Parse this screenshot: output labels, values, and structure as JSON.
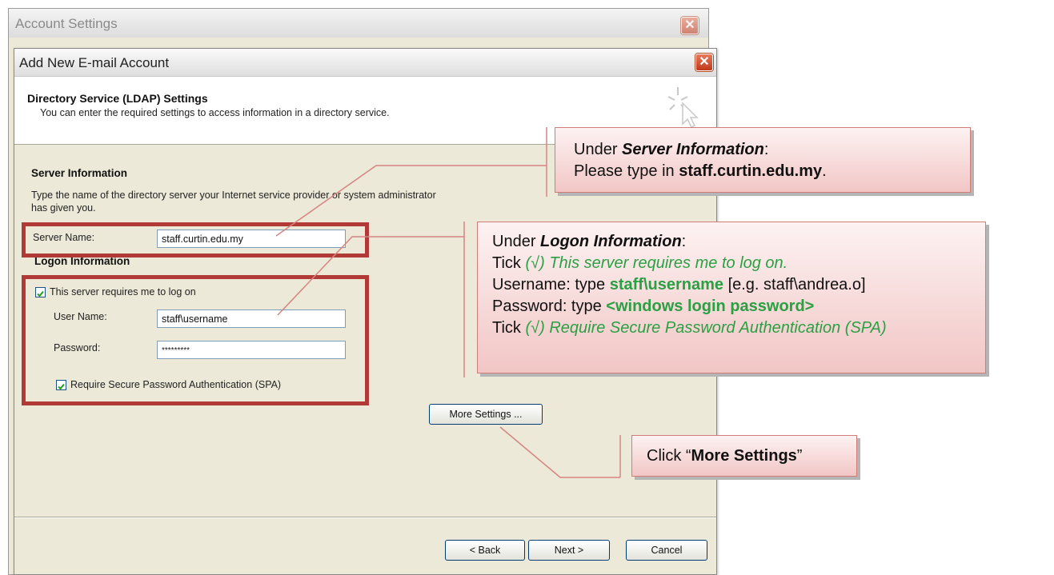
{
  "bg_window": {
    "title": "Account Settings"
  },
  "dialog": {
    "title": "Add New E-mail Account",
    "header_title": "Directory Service (LDAP) Settings",
    "header_desc": "You can enter the required settings to access information in a directory service.",
    "server_info": {
      "heading": "Server Information",
      "desc_line1": "Type the name of the directory server your Internet service provider or system administrator",
      "desc_line2": "has given you.",
      "server_name_label": "Server Name:",
      "server_name_value": "staff.curtin.edu.my"
    },
    "logon_info": {
      "heading": "Logon Information",
      "requires_logon_label": "This server requires me to log on",
      "requires_logon_checked": true,
      "username_label": "User Name:",
      "username_value": "staff\\username",
      "password_label": "Password:",
      "password_value": "*********",
      "spa_label": "Require Secure Password Authentication (SPA)",
      "spa_checked": true
    },
    "buttons": {
      "more_settings": "More Settings ...",
      "back": "< Back",
      "next": "Next >",
      "cancel": "Cancel"
    }
  },
  "callouts": {
    "server": {
      "line1_prefix": "Under ",
      "line1_em": "Server Information",
      "line1_suffix": ":",
      "line2_prefix": "Please type in ",
      "line2_bold": "staff.curtin.edu.my",
      "line2_suffix": "."
    },
    "logon": {
      "line1_prefix": "Under ",
      "line1_em": "Logon Information",
      "line1_suffix": ":",
      "line2_prefix": "Tick ",
      "line2_green": "(√) This server requires me to log on.",
      "line3_prefix": "Username: type ",
      "line3_green": "staff\\username",
      "line3_suffix": " [e.g. staff\\andrea.o]",
      "line4_prefix": "Password: type ",
      "line4_green": "<windows login password>",
      "line5_prefix": "Tick ",
      "line5_green": "(√) Require Secure Password Authentication (SPA)"
    },
    "more": {
      "prefix": "Click “",
      "bold": "More Settings",
      "suffix": "”"
    }
  },
  "colors": {
    "highlight_red": "#b13a36",
    "callout_green": "#2aa043",
    "callout_bg": "#f1c6c5"
  }
}
